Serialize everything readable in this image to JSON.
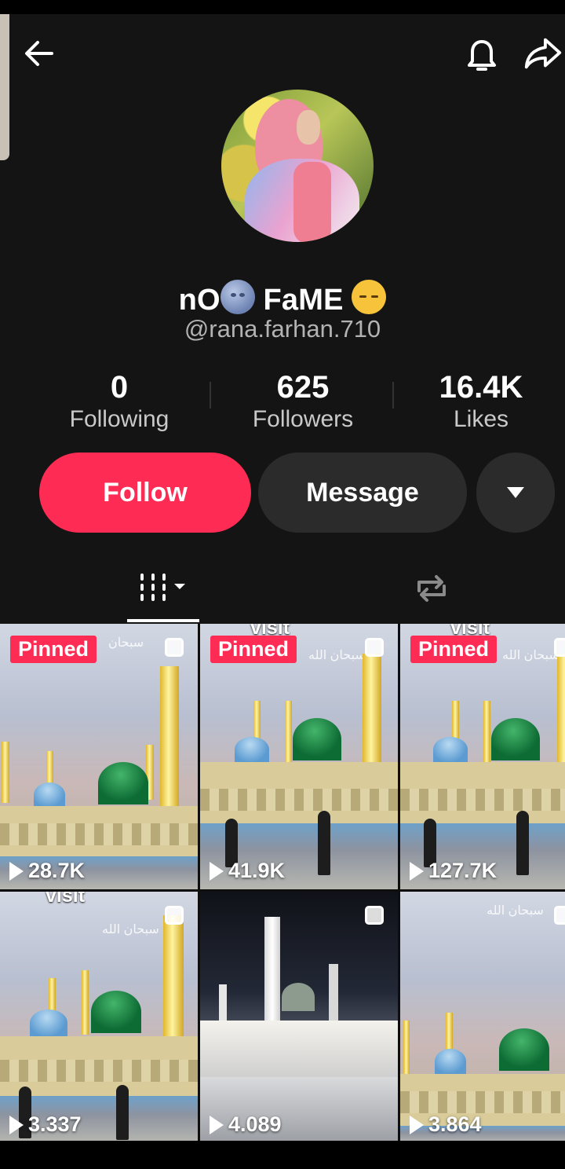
{
  "header": {
    "back_icon": "arrow-left-icon",
    "bell_icon": "bell-icon",
    "share_icon": "share-icon"
  },
  "profile": {
    "avatar": "avatar",
    "name_part1": "nO",
    "name_part2": "FaME",
    "name_icons": [
      "moon-emoji-icon",
      "sad-emoji-icon"
    ],
    "handle": "@rana.farhan.710"
  },
  "stats": [
    {
      "value": "0",
      "label": "Following"
    },
    {
      "value": "625",
      "label": "Followers"
    },
    {
      "value": "16.4K",
      "label": "Likes"
    }
  ],
  "actions": {
    "follow": "Follow",
    "message": "Message",
    "more_icon": "triangle-down-icon"
  },
  "tabs": [
    {
      "icon": "grid-icon",
      "selected": true
    },
    {
      "icon": "repost-icon",
      "selected": false
    }
  ],
  "videos": [
    {
      "pinned": "Pinned",
      "views": "28.7K",
      "overlay_text": "سبحان",
      "theme": "day"
    },
    {
      "pinned": "Pinned",
      "views": "41.9K",
      "overlay_text": "سبحان الله",
      "top_text": "visit",
      "theme": "day"
    },
    {
      "pinned": "Pinned",
      "views": "127.7K",
      "overlay_text": "سبحان الله",
      "top_text": "visit",
      "theme": "day"
    },
    {
      "views": "3.337",
      "overlay_text": "سبحان الله",
      "top_text": "visit",
      "theme": "day"
    },
    {
      "views": "4.089",
      "theme": "night"
    },
    {
      "views": "3.864",
      "overlay_text": "سبحان الله",
      "theme": "day"
    }
  ],
  "colors": {
    "accent": "#fe2c55",
    "background": "#141414",
    "secondary_button": "#2b2b2b"
  }
}
